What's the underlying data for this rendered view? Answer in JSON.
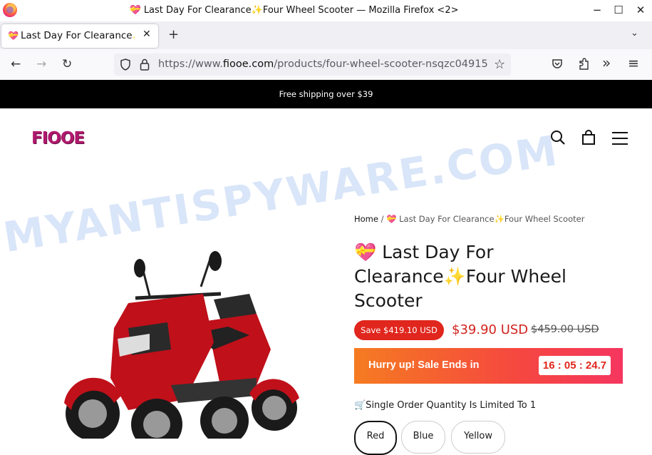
{
  "window": {
    "title": "💝 Last Day For Clearance✨Four Wheel Scooter — Mozilla Firefox <2>",
    "minimize": "−",
    "maximize": "☐",
    "close": "✕"
  },
  "tab": {
    "icon": "💝",
    "label": "Last Day For Clearance✨Four Wheel Scooter",
    "close": "✕",
    "new_tab": "+",
    "list_all": "⌄"
  },
  "nav": {
    "back": "←",
    "forward": "→",
    "reload": "↻",
    "url_scheme": "https://www.",
    "url_host": "fiooe.com",
    "url_path": "/products/four-wheel-scooter-nsqzc04915",
    "bookmark": "☆",
    "overflow": "»",
    "menu": "≡"
  },
  "site": {
    "announcement": "Free shipping over $39",
    "logo": "FIOOE",
    "watermark": "MYANTISPYWARE.COM"
  },
  "product": {
    "breadcrumb_home": "Home",
    "breadcrumb_sep": "/",
    "breadcrumb_current": "💝 Last Day For Clearance✨Four Wheel Scooter",
    "title": "💝 Last Day For Clearance✨Four Wheel Scooter",
    "save_badge": "Save $419.10 USD",
    "price": "$39.90 USD",
    "compare_price": "$459.00 USD",
    "hurry_text": "Hurry up! Sale Ends in",
    "timer": "16 : 05 : 24.7",
    "qty_note": "🛒Single Order Quantity Is Limited To 1",
    "variants": [
      "Red",
      "Blue",
      "Yellow"
    ]
  },
  "colors": {
    "accent_red": "#e0261d",
    "logo": "#b0196e",
    "scooter": "#c0101a"
  }
}
